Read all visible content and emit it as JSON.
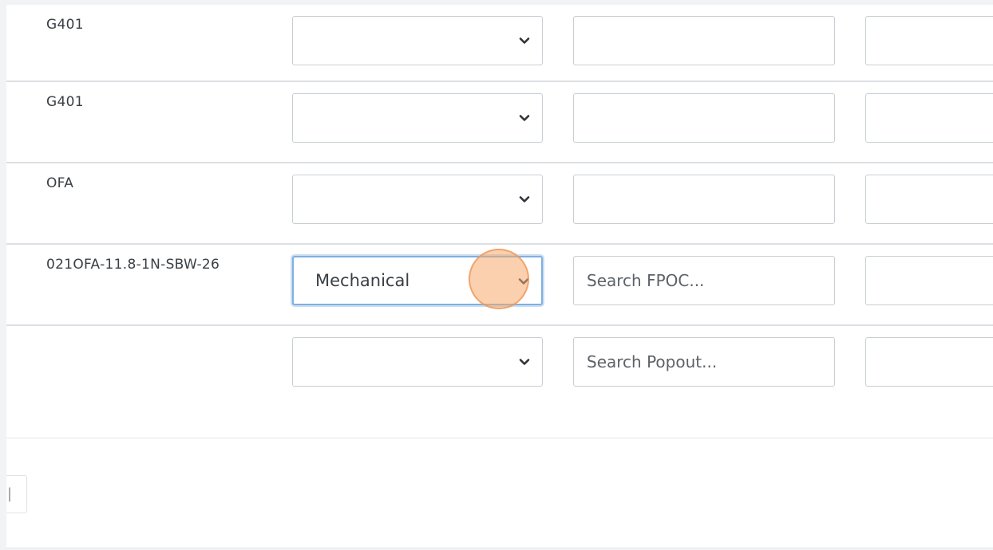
{
  "rows": [
    {
      "label": "G401",
      "select_value": "",
      "text_value": "",
      "text_placeholder": ""
    },
    {
      "label": "G401",
      "select_value": "",
      "text_value": "",
      "text_placeholder": ""
    },
    {
      "label": "OFA",
      "select_value": "",
      "text_value": "",
      "text_placeholder": ""
    },
    {
      "label": "021OFA-11.8-1N-SBW-26",
      "select_value": "Mechanical",
      "text_value": "",
      "text_placeholder": "Search FPOC..."
    },
    {
      "label": "",
      "select_value": "",
      "text_value": "",
      "text_placeholder": "Search Popout..."
    }
  ],
  "pager": {
    "glyph": "|"
  },
  "icons": {
    "dropdown": "chevron-down-icon"
  },
  "colors": {
    "focus_border": "#7fb0e0",
    "click_indicator": "#f5aa6e"
  }
}
